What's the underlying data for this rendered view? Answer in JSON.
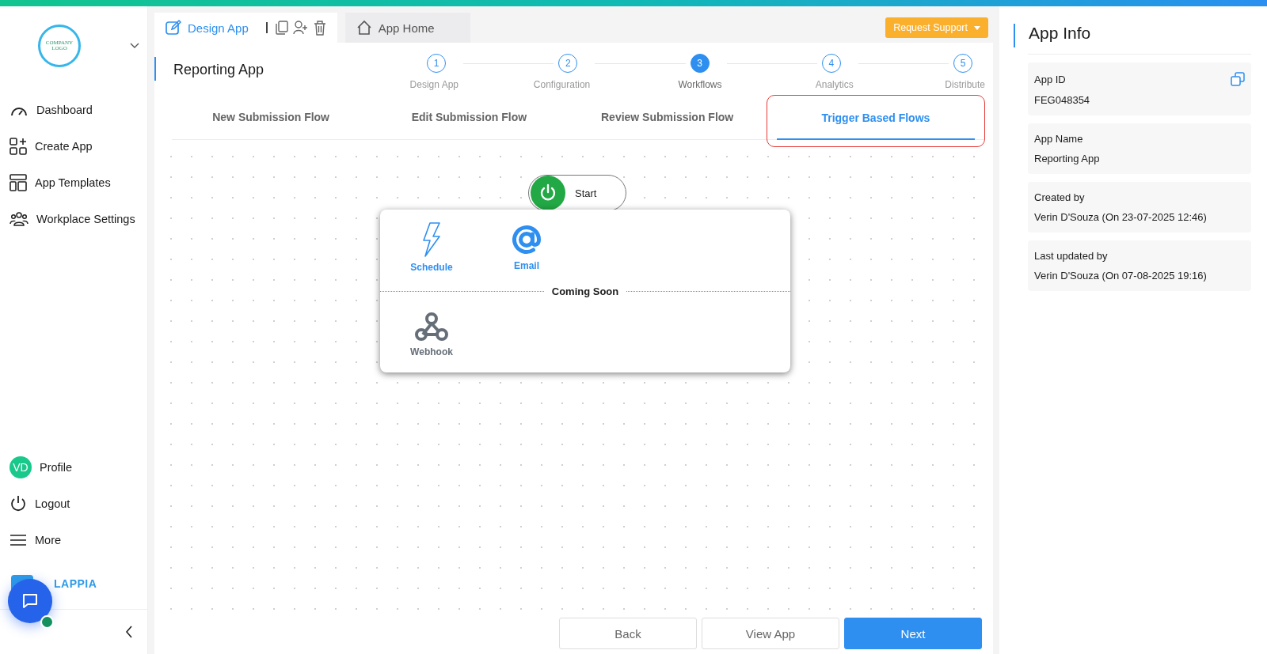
{
  "sidebar": {
    "logo_text": [
      "COMPANY",
      "LOGO"
    ],
    "nav": [
      {
        "kind": "dashboard",
        "label": "Dashboard"
      },
      {
        "kind": "create",
        "label": "Create App"
      },
      {
        "kind": "templates",
        "label": "App Templates"
      },
      {
        "kind": "settings",
        "label": "Workplace Settings"
      }
    ],
    "profile": {
      "initials": "VD",
      "label": "Profile"
    },
    "bottom": [
      {
        "kind": "logout",
        "label": "Logout"
      },
      {
        "kind": "more",
        "label": "More"
      }
    ],
    "brand": "LAPPIA"
  },
  "top_tabs": [
    {
      "kind": "design",
      "label": "Design App",
      "selected": true
    },
    {
      "kind": "home",
      "label": "App Home",
      "selected": false
    }
  ],
  "request_support": "Request Support",
  "app_title": "Reporting App",
  "steps": [
    {
      "number": "1",
      "label": "Design App",
      "selected": false
    },
    {
      "number": "2",
      "label": "Configuration",
      "selected": false
    },
    {
      "number": "3",
      "label": "Workflows",
      "selected": true
    },
    {
      "number": "4",
      "label": "Analytics",
      "selected": false
    },
    {
      "number": "5",
      "label": "Distribute",
      "selected": false
    }
  ],
  "flow_tabs": [
    {
      "label": "New Submission Flow",
      "selected": false,
      "outlined": false
    },
    {
      "label": "Edit Submission Flow",
      "selected": false,
      "outlined": false
    },
    {
      "label": "Review Submission Flow",
      "selected": false,
      "outlined": false
    },
    {
      "label": "Trigger Based Flows",
      "selected": true,
      "outlined": true
    }
  ],
  "start_node": {
    "label": "Start"
  },
  "trigger_menu": {
    "available": [
      {
        "kind": "schedule",
        "label": "Schedule"
      },
      {
        "kind": "email",
        "label": "Email"
      }
    ],
    "separator": "Coming Soon",
    "coming_soon": [
      {
        "kind": "webhook",
        "label": "Webhook"
      }
    ]
  },
  "footer_buttons": [
    {
      "label": "Back",
      "primary": false
    },
    {
      "label": "View App",
      "primary": false
    },
    {
      "label": "Next",
      "primary": true
    }
  ],
  "app_info": {
    "title": "App Info",
    "fields": [
      {
        "label": "App ID",
        "value": "FEG048354",
        "copyable": true
      },
      {
        "label": "App Name",
        "value": "Reporting App",
        "copyable": false
      },
      {
        "label": "Created by",
        "value": "Verin D'Souza (On 23-07-2025 12:46)",
        "copyable": false
      },
      {
        "label": "Last updated by",
        "value": "Verin D'Souza (On 07-08-2025 19:16)",
        "copyable": false
      }
    ]
  }
}
